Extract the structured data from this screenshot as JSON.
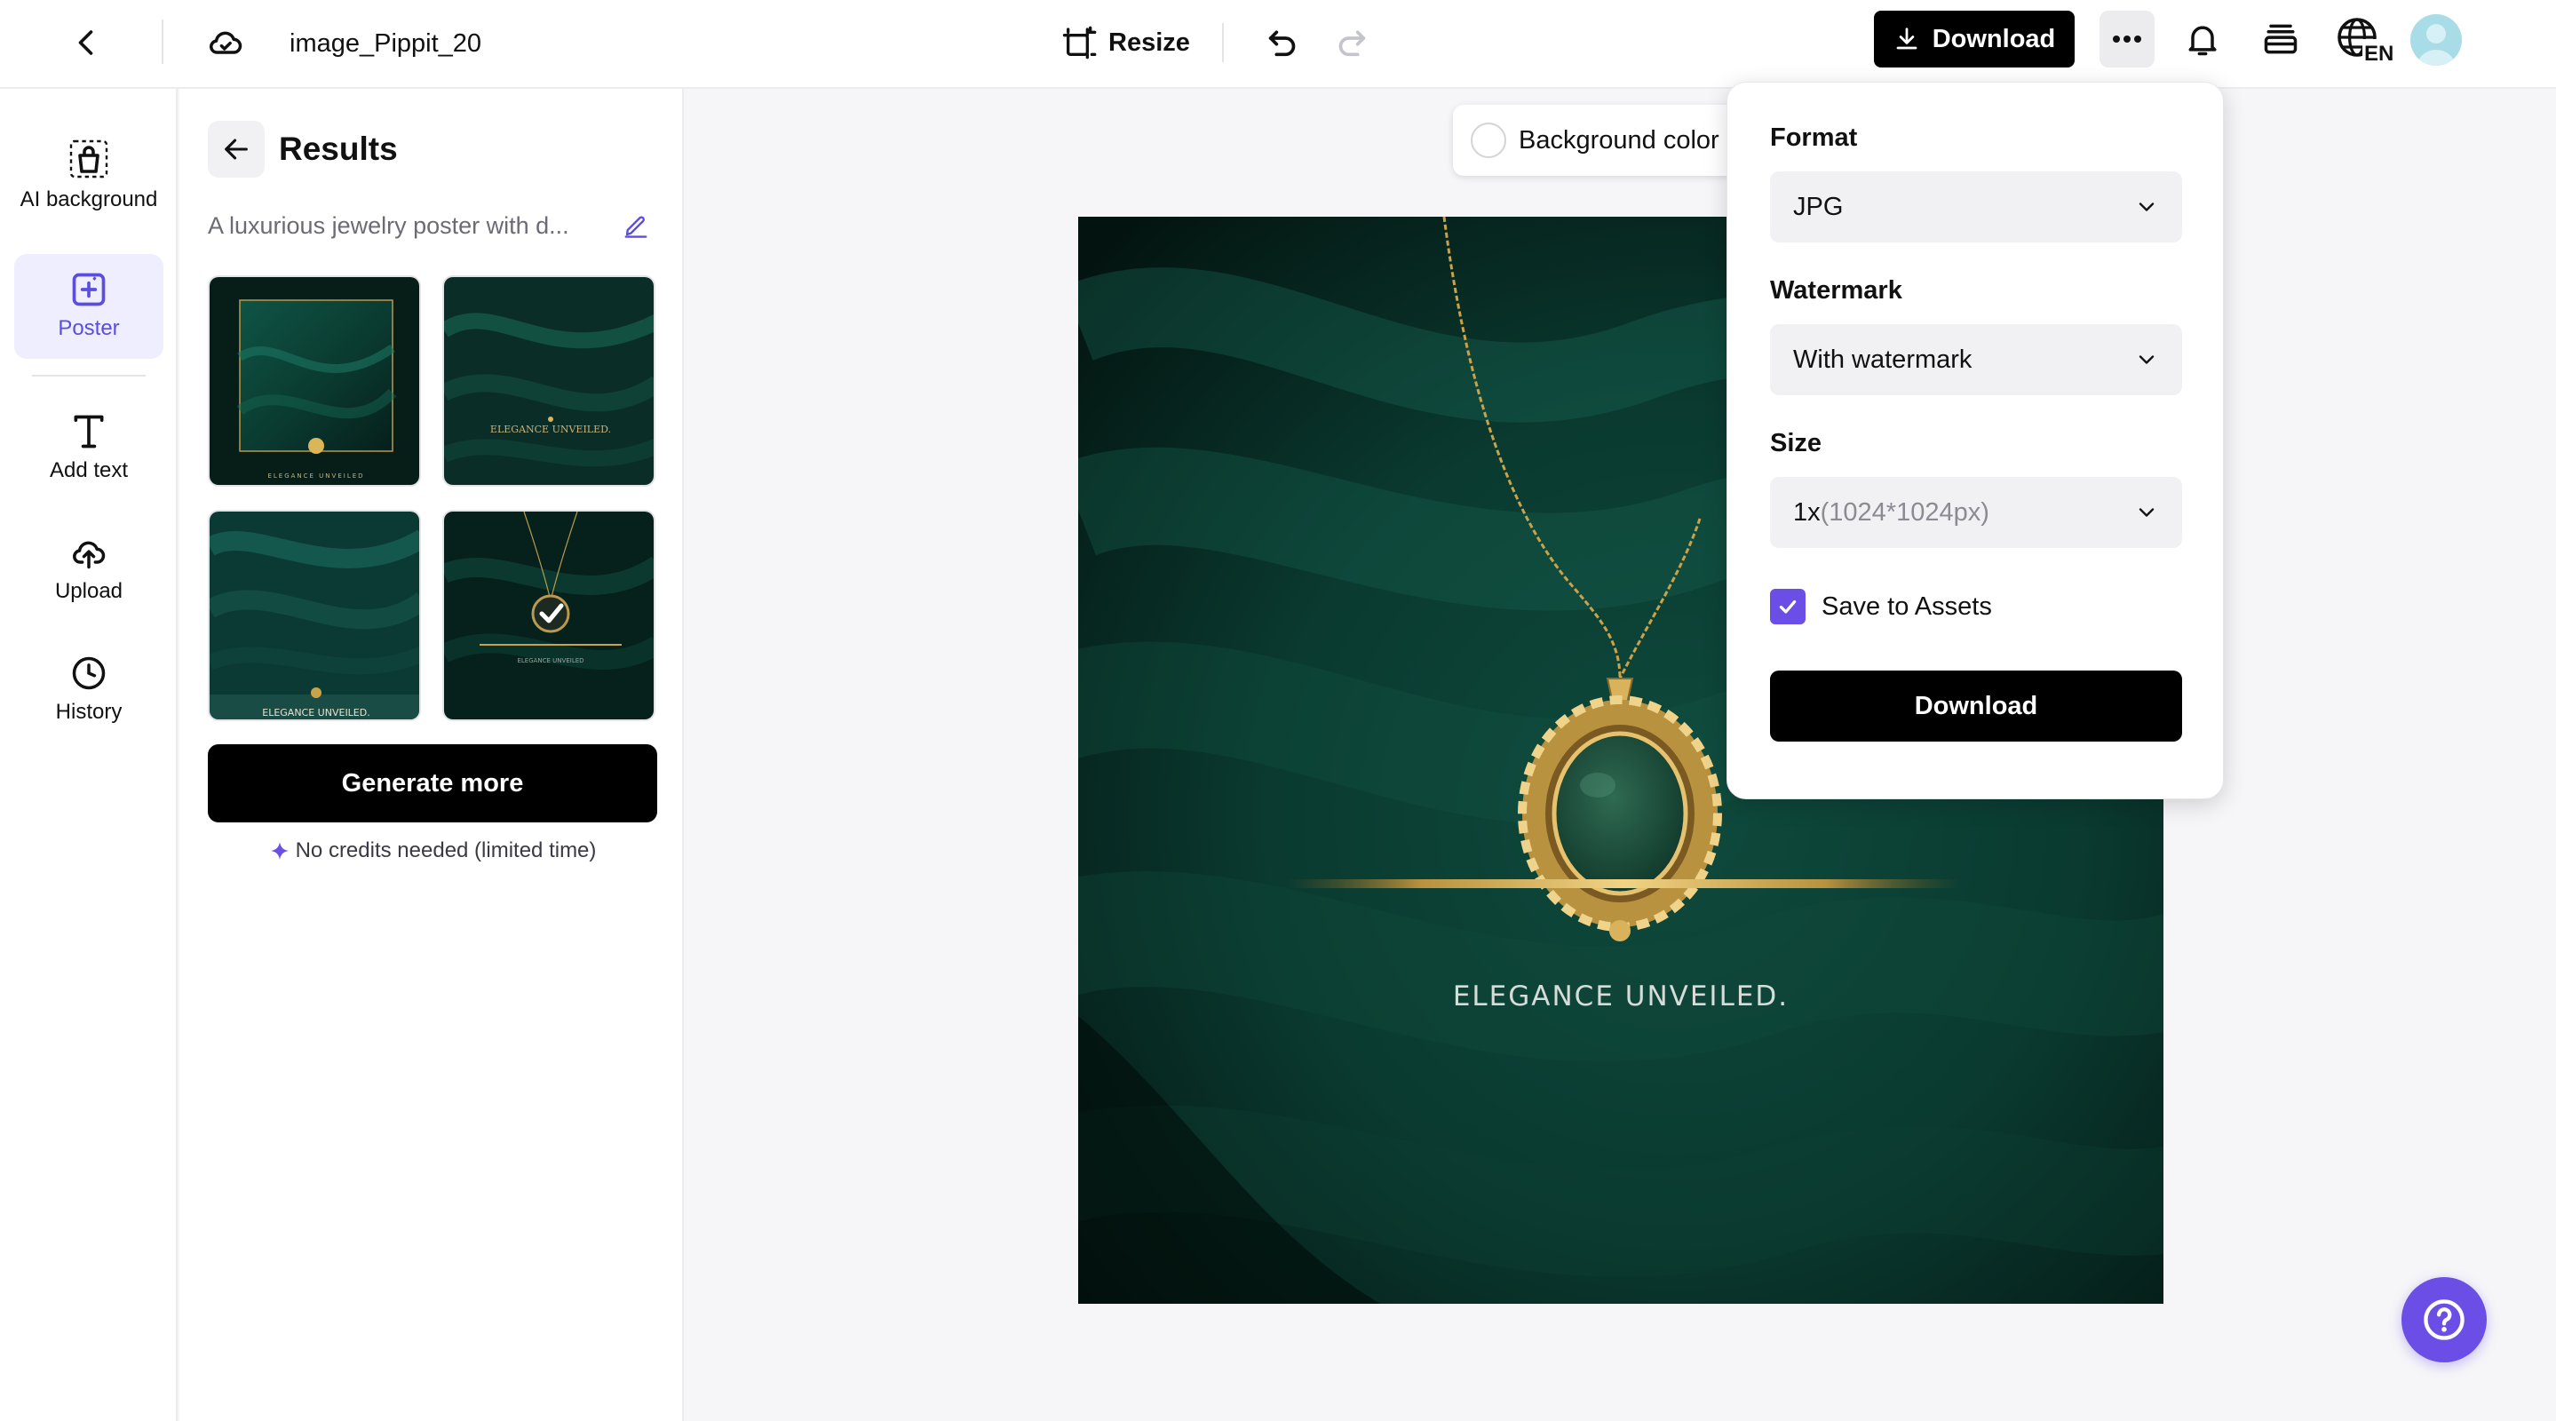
{
  "topbar": {
    "project_title": "image_Pippit_20",
    "resize_label": "Resize",
    "download_label": "Download",
    "lang_badge": "EN"
  },
  "rail": {
    "items": [
      {
        "label": "AI background",
        "icon": "bag-icon"
      },
      {
        "label": "Poster",
        "icon": "poster-icon",
        "active": true
      },
      {
        "label": "Add text",
        "icon": "text-icon"
      },
      {
        "label": "Upload",
        "icon": "upload-cloud-icon"
      },
      {
        "label": "History",
        "icon": "clock-icon"
      }
    ]
  },
  "results": {
    "title": "Results",
    "prompt": "A luxurious jewelry poster with d...",
    "thumbnails": [
      {
        "caption": "ELEGANCE UNVEILED"
      },
      {
        "caption": "ELEGANCE UNVEILED."
      },
      {
        "caption": "ELEGANCE UNVEILED."
      },
      {
        "caption": "ELEGANCE UNVEILED"
      }
    ],
    "generate_label": "Generate more",
    "credits_note": "No credits needed (limited time)"
  },
  "canvas": {
    "background_color_label": "Background color",
    "poster_text": "ELEGANCE UNVEILED."
  },
  "download_panel": {
    "format_label": "Format",
    "format_value": "JPG",
    "watermark_label": "Watermark",
    "watermark_value": "With watermark",
    "size_label": "Size",
    "size_value": "1x",
    "size_detail": "(1024*1024px)",
    "save_to_assets_label": "Save to Assets",
    "save_to_assets_checked": true,
    "download_button": "Download"
  },
  "colors": {
    "accent": "#6a4ee6",
    "poster_green": "#0b3b30",
    "gold": "#c9a24a"
  }
}
